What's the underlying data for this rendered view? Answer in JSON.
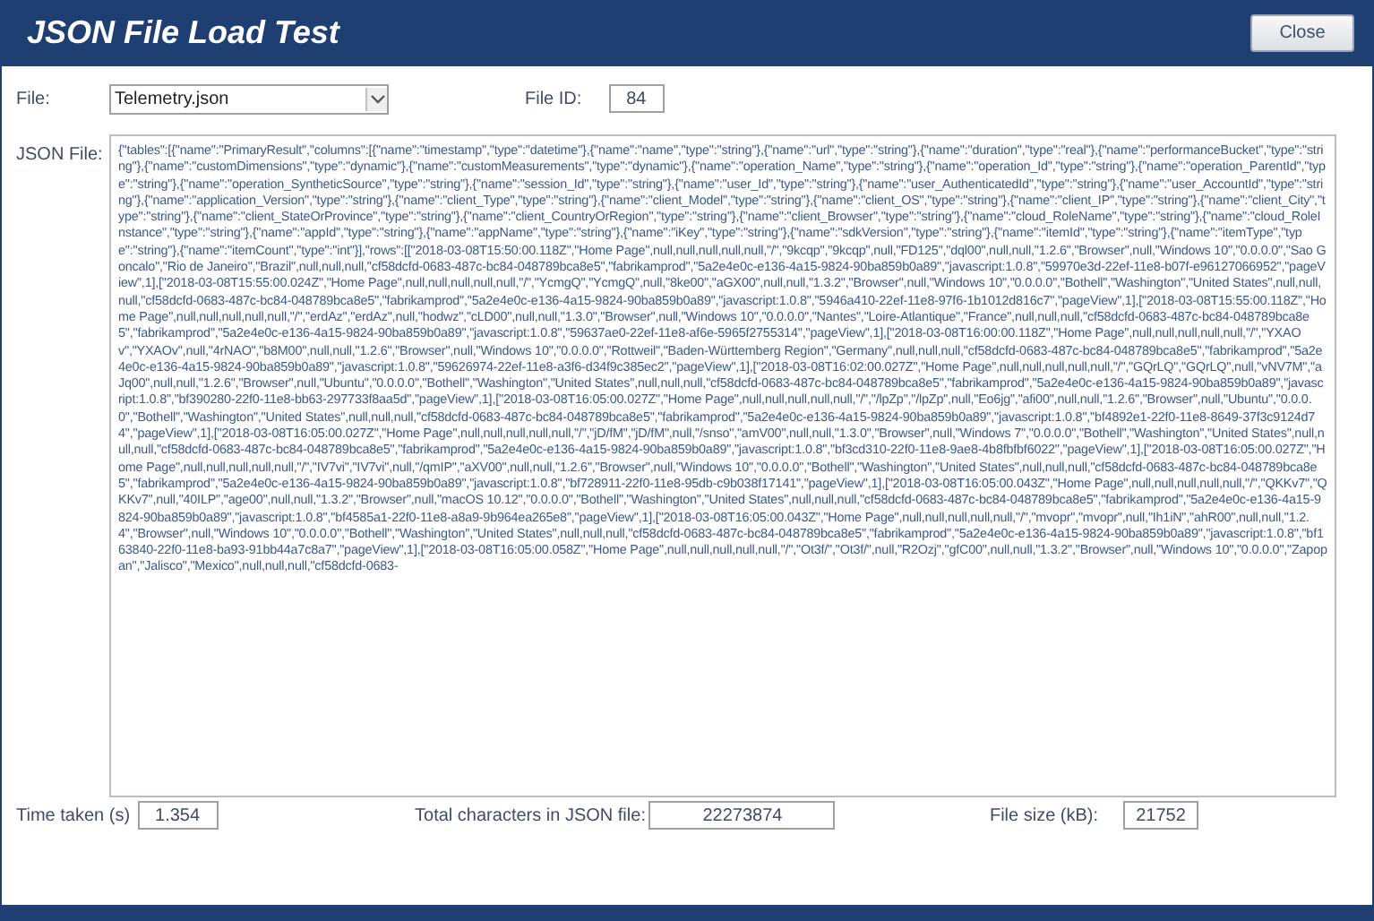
{
  "window": {
    "title": "JSON File Load Test"
  },
  "close_button": "Close",
  "file": {
    "label": "File:",
    "value": "Telemetry.json"
  },
  "file_id": {
    "label": "File ID:",
    "value": "84"
  },
  "json_file": {
    "label": "JSON File:",
    "value": "{\"tables\":[{\"name\":\"PrimaryResult\",\"columns\":[{\"name\":\"timestamp\",\"type\":\"datetime\"},{\"name\":\"name\",\"type\":\"string\"},{\"name\":\"url\",\"type\":\"string\"},{\"name\":\"duration\",\"type\":\"real\"},{\"name\":\"performanceBucket\",\"type\":\"string\"},{\"name\":\"customDimensions\",\"type\":\"dynamic\"},{\"name\":\"customMeasurements\",\"type\":\"dynamic\"},{\"name\":\"operation_Name\",\"type\":\"string\"},{\"name\":\"operation_Id\",\"type\":\"string\"},{\"name\":\"operation_ParentId\",\"type\":\"string\"},{\"name\":\"operation_SyntheticSource\",\"type\":\"string\"},{\"name\":\"session_Id\",\"type\":\"string\"},{\"name\":\"user_Id\",\"type\":\"string\"},{\"name\":\"user_AuthenticatedId\",\"type\":\"string\"},{\"name\":\"user_AccountId\",\"type\":\"string\"},{\"name\":\"application_Version\",\"type\":\"string\"},{\"name\":\"client_Type\",\"type\":\"string\"},{\"name\":\"client_Model\",\"type\":\"string\"},{\"name\":\"client_OS\",\"type\":\"string\"},{\"name\":\"client_IP\",\"type\":\"string\"},{\"name\":\"client_City\",\"type\":\"string\"},{\"name\":\"client_StateOrProvince\",\"type\":\"string\"},{\"name\":\"client_CountryOrRegion\",\"type\":\"string\"},{\"name\":\"client_Browser\",\"type\":\"string\"},{\"name\":\"cloud_RoleName\",\"type\":\"string\"},{\"name\":\"cloud_RoleInstance\",\"type\":\"string\"},{\"name\":\"appId\",\"type\":\"string\"},{\"name\":\"appName\",\"type\":\"string\"},{\"name\":\"iKey\",\"type\":\"string\"},{\"name\":\"sdkVersion\",\"type\":\"string\"},{\"name\":\"itemId\",\"type\":\"string\"},{\"name\":\"itemType\",\"type\":\"string\"},{\"name\":\"itemCount\",\"type\":\"int\"}],\"rows\":[[\"2018-03-08T15:50:00.118Z\",\"Home Page\",null,null,null,null,null,\"/\",\"9kcqp\",\"9kcqp\",null,\"FD125\",\"dql00\",null,null,\"1.2.6\",\"Browser\",null,\"Windows 10\",\"0.0.0.0\",\"Sao Goncalo\",\"Rio de Janeiro\",\"Brazil\",null,null,null,\"cf58dcfd-0683-487c-bc84-048789bca8e5\",\"fabrikamprod\",\"5a2e4e0c-e136-4a15-9824-90ba859b0a89\",\"javascript:1.0.8\",\"59970e3d-22ef-11e8-b07f-e96127066952\",\"pageView\",1],[\"2018-03-08T15:55:00.024Z\",\"Home Page\",null,null,null,null,null,\"/\",\"YcmgQ\",\"YcmgQ\",null,\"8ke00\",\"aGX00\",null,null,\"1.3.2\",\"Browser\",null,\"Windows 10\",\"0.0.0.0\",\"Bothell\",\"Washington\",\"United States\",null,null,null,\"cf58dcfd-0683-487c-bc84-048789bca8e5\",\"fabrikamprod\",\"5a2e4e0c-e136-4a15-9824-90ba859b0a89\",\"javascript:1.0.8\",\"5946a410-22ef-11e8-97f6-1b1012d816c7\",\"pageView\",1],[\"2018-03-08T15:55:00.118Z\",\"Home Page\",null,null,null,null,null,\"/\",\"erdAz\",\"erdAz\",null,\"hodwz\",\"cLD00\",null,null,\"1.3.0\",\"Browser\",null,\"Windows 10\",\"0.0.0.0\",\"Nantes\",\"Loire-Atlantique\",\"France\",null,null,null,\"cf58dcfd-0683-487c-bc84-048789bca8e5\",\"fabrikamprod\",\"5a2e4e0c-e136-4a15-9824-90ba859b0a89\",\"javascript:1.0.8\",\"59637ae0-22ef-11e8-af6e-5965f2755314\",\"pageView\",1],[\"2018-03-08T16:00:00.118Z\",\"Home Page\",null,null,null,null,null,\"/\",\"YXAOv\",\"YXAOv\",null,\"4rNAO\",\"b8M00\",null,null,\"1.2.6\",\"Browser\",null,\"Windows 10\",\"0.0.0.0\",\"Rottweil\",\"Baden-Württemberg Region\",\"Germany\",null,null,null,\"cf58dcfd-0683-487c-bc84-048789bca8e5\",\"fabrikamprod\",\"5a2e4e0c-e136-4a15-9824-90ba859b0a89\",\"javascript:1.0.8\",\"59626974-22ef-11e8-a3f6-d34f9c385ec2\",\"pageView\",1],[\"2018-03-08T16:02:00.027Z\",\"Home Page\",null,null,null,null,null,\"/\",\"GQrLQ\",\"GQrLQ\",null,\"vNV7M\",\"aJq00\",null,null,\"1.2.6\",\"Browser\",null,\"Ubuntu\",\"0.0.0.0\",\"Bothell\",\"Washington\",\"United States\",null,null,null,\"cf58dcfd-0683-487c-bc84-048789bca8e5\",\"fabrikamprod\",\"5a2e4e0c-e136-4a15-9824-90ba859b0a89\",\"javascript:1.0.8\",\"bf390280-22f0-11e8-bb63-297733f8aa5d\",\"pageView\",1],[\"2018-03-08T16:05:00.027Z\",\"Home Page\",null,null,null,null,null,\"/\",\"/lpZp\",\"/lpZp\",null,\"Eo6jg\",\"afi00\",null,null,\"1.2.6\",\"Browser\",null,\"Ubuntu\",\"0.0.0.0\",\"Bothell\",\"Washington\",\"United States\",null,null,null,\"cf58dcfd-0683-487c-bc84-048789bca8e5\",\"fabrikamprod\",\"5a2e4e0c-e136-4a15-9824-90ba859b0a89\",\"javascript:1.0.8\",\"bf4892e1-22f0-11e8-8649-37f3c9124d74\",\"pageView\",1],[\"2018-03-08T16:05:00.027Z\",\"Home Page\",null,null,null,null,null,\"/\",\"jD/fM\",\"jD/fM\",null,\"/snso\",\"amV00\",null,null,\"1.3.0\",\"Browser\",null,\"Windows 7\",\"0.0.0.0\",\"Bothell\",\"Washington\",\"United States\",null,null,null,\"cf58dcfd-0683-487c-bc84-048789bca8e5\",\"fabrikamprod\",\"5a2e4e0c-e136-4a15-9824-90ba859b0a89\",\"javascript:1.0.8\",\"bf3cd310-22f0-11e8-9ae8-4b8fbfbf6022\",\"pageView\",1],[\"2018-03-08T16:05:00.027Z\",\"Home Page\",null,null,null,null,null,\"/\",\"IV7vi\",\"IV7vi\",null,\"/qmIP\",\"aXV00\",null,null,\"1.2.6\",\"Browser\",null,\"Windows 10\",\"0.0.0.0\",\"Bothell\",\"Washington\",\"United States\",null,null,null,\"cf58dcfd-0683-487c-bc84-048789bca8e5\",\"fabrikamprod\",\"5a2e4e0c-e136-4a15-9824-90ba859b0a89\",\"javascript:1.0.8\",\"bf728911-22f0-11e8-95db-c9b038f17141\",\"pageView\",1],[\"2018-03-08T16:05:00.043Z\",\"Home Page\",null,null,null,null,null,\"/\",\"QKKv7\",\"QKKv7\",null,\"40ILP\",\"age00\",null,null,\"1.3.2\",\"Browser\",null,\"macOS 10.12\",\"0.0.0.0\",\"Bothell\",\"Washington\",\"United States\",null,null,null,\"cf58dcfd-0683-487c-bc84-048789bca8e5\",\"fabrikamprod\",\"5a2e4e0c-e136-4a15-9824-90ba859b0a89\",\"javascript:1.0.8\",\"bf4585a1-22f0-11e8-a8a9-9b964ea265e8\",\"pageView\",1],[\"2018-03-08T16:05:00.043Z\",\"Home Page\",null,null,null,null,null,\"/\",\"mvopr\",\"mvopr\",null,\"Ih1iN\",\"ahR00\",null,null,\"1.2.4\",\"Browser\",null,\"Windows 10\",\"0.0.0.0\",\"Bothell\",\"Washington\",\"United States\",null,null,null,\"cf58dcfd-0683-487c-bc84-048789bca8e5\",\"fabrikamprod\",\"5a2e4e0c-e136-4a15-9824-90ba859b0a89\",\"javascript:1.0.8\",\"bf163840-22f0-11e8-ba93-91bb44a7c8a7\",\"pageView\",1],[\"2018-03-08T16:05:00.058Z\",\"Home Page\",null,null,null,null,null,\"/\",\"Ot3f/\",\"Ot3f/\",null,\"R2Ozj\",\"gfC00\",null,null,\"1.3.2\",\"Browser\",null,\"Windows 10\",\"0.0.0.0\",\"Zapopan\",\"Jalisco\",\"Mexico\",null,null,null,\"cf58dcfd-0683-"
  },
  "time_taken": {
    "label": "Time taken (s)",
    "value": "1.354"
  },
  "total_characters": {
    "label": "Total characters in JSON file:",
    "value": "22273874"
  },
  "file_size": {
    "label": "File size (kB):",
    "value": "21752"
  }
}
